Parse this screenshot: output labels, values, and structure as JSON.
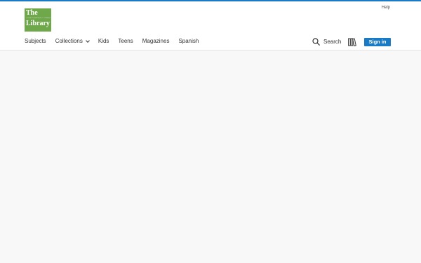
{
  "logo": {
    "line1": "The",
    "tagline": "YOUR COMMUNITY PUBLIC LIBRARY",
    "line2": "Library",
    "brand_color": "#6ea84a"
  },
  "header": {
    "help_label": "Help",
    "accent_color": "#1a7bc4"
  },
  "nav": {
    "items": [
      {
        "label": "Subjects"
      },
      {
        "label": "Collections",
        "has_dropdown": true
      },
      {
        "label": "Kids"
      },
      {
        "label": "Teens"
      },
      {
        "label": "Magazines"
      },
      {
        "label": "Spanish"
      }
    ]
  },
  "actions": {
    "search_label": "Search",
    "shelf_icon": "books-shelf-icon",
    "signin_label": "Sign in"
  }
}
